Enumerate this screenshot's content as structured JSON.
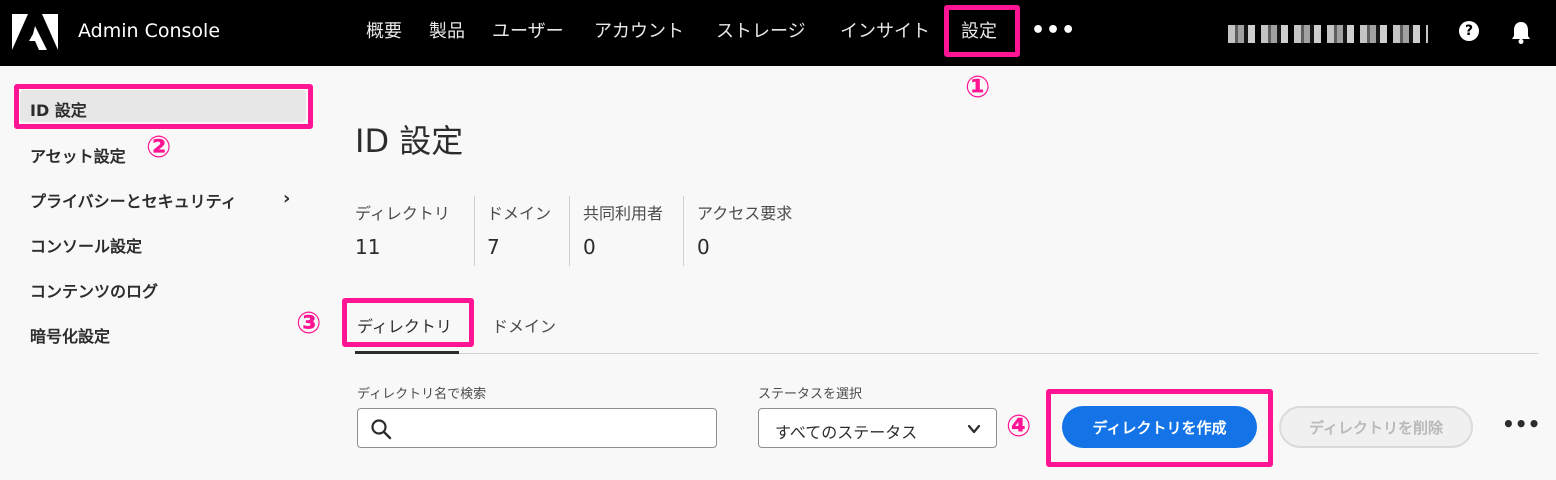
{
  "app": {
    "title": "Admin Console"
  },
  "nav": {
    "items": [
      "概要",
      "製品",
      "ユーザー",
      "アカウント",
      "ストレージ",
      "インサイト",
      "設定"
    ],
    "more": "•••"
  },
  "help_label": "?",
  "sidebar": {
    "items": [
      "ID 設定",
      "アセット設定",
      "プライバシーとセキュリティ",
      "コンソール設定",
      "コンテンツのログ",
      "暗号化設定"
    ],
    "chevron": "›"
  },
  "page": {
    "title": "ID 設定"
  },
  "stats": [
    {
      "label": "ディレクトリ",
      "value": "11"
    },
    {
      "label": "ドメイン",
      "value": "7"
    },
    {
      "label": "共同利用者",
      "value": "0"
    },
    {
      "label": "アクセス要求",
      "value": "0"
    }
  ],
  "tabs": [
    "ディレクトリ",
    "ドメイン"
  ],
  "search": {
    "label": "ディレクトリ名で検索",
    "value": "",
    "placeholder": ""
  },
  "status_select": {
    "label": "ステータスを選択",
    "value": "すべてのステータス"
  },
  "buttons": {
    "create": "ディレクトリを作成",
    "delete": "ディレクトリを削除",
    "more": "•••"
  },
  "callouts": [
    "①",
    "②",
    "③",
    "④"
  ],
  "colors": {
    "accent": "#1473e6",
    "highlight": "#ff1493",
    "topbar": "#000000"
  }
}
